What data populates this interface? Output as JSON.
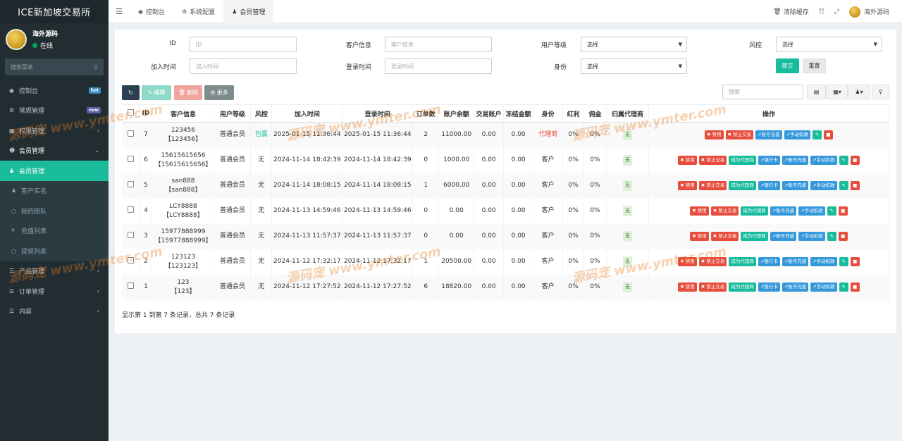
{
  "app": {
    "title": "ICE新加坡交易所"
  },
  "user": {
    "name": "海外源码",
    "status": "在线"
  },
  "sidebar": {
    "search_placeholder": "搜索菜单",
    "items": [
      {
        "label": "控制台",
        "badge": "hot",
        "badge_color": "#3c8dbc"
      },
      {
        "label": "常规管理",
        "badge": "new",
        "badge_color": "#605ca8"
      },
      {
        "label": "权限管理"
      },
      {
        "label": "会员管理"
      },
      {
        "label": "会员管理"
      },
      {
        "label": "客户实名"
      },
      {
        "label": "我的团队"
      },
      {
        "label": "充值列表"
      },
      {
        "label": "提现列表"
      },
      {
        "label": "产品管理"
      },
      {
        "label": "订单管理"
      },
      {
        "label": "内容"
      }
    ]
  },
  "topbar": {
    "tabs": [
      "控制台",
      "系统配置",
      "会员管理"
    ],
    "clear_cache": "清除缓存",
    "user_name": "海外源码"
  },
  "filters": {
    "id_label": "ID",
    "id_placeholder": "ID",
    "info_label": "客户信息",
    "info_placeholder": "客户信息",
    "level_label": "用户等级",
    "level_value": "选择",
    "risk_label": "风控",
    "risk_value": "选择",
    "join_label": "加入时间",
    "join_placeholder": "加入时间",
    "login_label": "登录时间",
    "login_placeholder": "登录时间",
    "identity_label": "身份",
    "identity_value": "选择",
    "submit": "提交",
    "reset": "重置"
  },
  "toolbar": {
    "edit": "编辑",
    "delete": "删除",
    "more": "更多",
    "search_placeholder": "搜索"
  },
  "table": {
    "headers": [
      "ID",
      "客户信息",
      "用户等级",
      "风控",
      "加入时间",
      "登录时间",
      "订单数",
      "账户余额",
      "交易账户",
      "冻结金额",
      "身份",
      "红利",
      "佣金",
      "归属代理商",
      "操作"
    ],
    "rows": [
      {
        "id": "7",
        "info1": "123456",
        "info2": "【123456】",
        "level": "普通会员",
        "risk": "包赢",
        "join": "2025-01-15 11:36:44",
        "login": "2025-01-15 11:36:44",
        "orders": "2",
        "balance": "11000.00",
        "trade": "0.00",
        "frozen": "0.00",
        "identity": "代理商",
        "bonus": "0%",
        "commission": "0%",
        "agent": "无"
      },
      {
        "id": "6",
        "info1": "15615615656",
        "info2": "【15615615656】",
        "level": "普通会员",
        "risk": "无",
        "join": "2024-11-14 18:42:39",
        "login": "2024-11-14 18:42:39",
        "orders": "0",
        "balance": "1000.00",
        "trade": "0.00",
        "frozen": "0.00",
        "identity": "客户",
        "bonus": "0%",
        "commission": "0%",
        "agent": "无"
      },
      {
        "id": "5",
        "info1": "san888",
        "info2": "【san888】",
        "level": "普通会员",
        "risk": "无",
        "join": "2024-11-14 18:08:15",
        "login": "2024-11-14 18:08:15",
        "orders": "1",
        "balance": "6000.00",
        "trade": "0.00",
        "frozen": "0.00",
        "identity": "客户",
        "bonus": "0%",
        "commission": "0%",
        "agent": "无"
      },
      {
        "id": "4",
        "info1": "LCY8888",
        "info2": "【LCY8888】",
        "level": "普通会员",
        "risk": "无",
        "join": "2024-11-13 14:59:46",
        "login": "2024-11-13 14:59:46",
        "orders": "0",
        "balance": "0.00",
        "trade": "0.00",
        "frozen": "0.00",
        "identity": "客户",
        "bonus": "0%",
        "commission": "0%",
        "agent": "无"
      },
      {
        "id": "3",
        "info1": "15977888999",
        "info2": "【15977888999】",
        "level": "普通会员",
        "risk": "无",
        "join": "2024-11-13 11:57:37",
        "login": "2024-11-13 11:57:37",
        "orders": "0",
        "balance": "0.00",
        "trade": "0.00",
        "frozen": "0.00",
        "identity": "客户",
        "bonus": "0%",
        "commission": "0%",
        "agent": "无"
      },
      {
        "id": "2",
        "info1": "123123",
        "info2": "【123123】",
        "level": "普通会员",
        "risk": "无",
        "join": "2024-11-12 17:32:17",
        "login": "2024-11-12 17:32:17",
        "orders": "1",
        "balance": "20500.00",
        "trade": "0.00",
        "frozen": "0.00",
        "identity": "客户",
        "bonus": "0%",
        "commission": "0%",
        "agent": "无"
      },
      {
        "id": "1",
        "info1": "123",
        "info2": "【123】",
        "level": "普通会员",
        "risk": "无",
        "join": "2024-11-12 17:27:52",
        "login": "2024-11-12 17:27:52",
        "orders": "6",
        "balance": "18820.00",
        "trade": "0.00",
        "frozen": "0.00",
        "identity": "客户",
        "bonus": "0%",
        "commission": "0%",
        "agent": "无"
      }
    ],
    "ops": {
      "ban": "禁用",
      "no_trade": "禁止交易",
      "make_agent": "成为代理商",
      "bank_card": "银行卡",
      "recharge": "账号充值",
      "deduct": "手动扣款"
    }
  },
  "footer": {
    "summary": "显示第 1 到第 7 条记录，总共 7 条记录"
  },
  "watermark": {
    "site": "www.ymter.com",
    "brand": "源码宠"
  },
  "colors": {
    "sidebar": "#222d32",
    "accent": "#1abc9c",
    "danger": "#e74c3c",
    "info": "#3498db"
  }
}
